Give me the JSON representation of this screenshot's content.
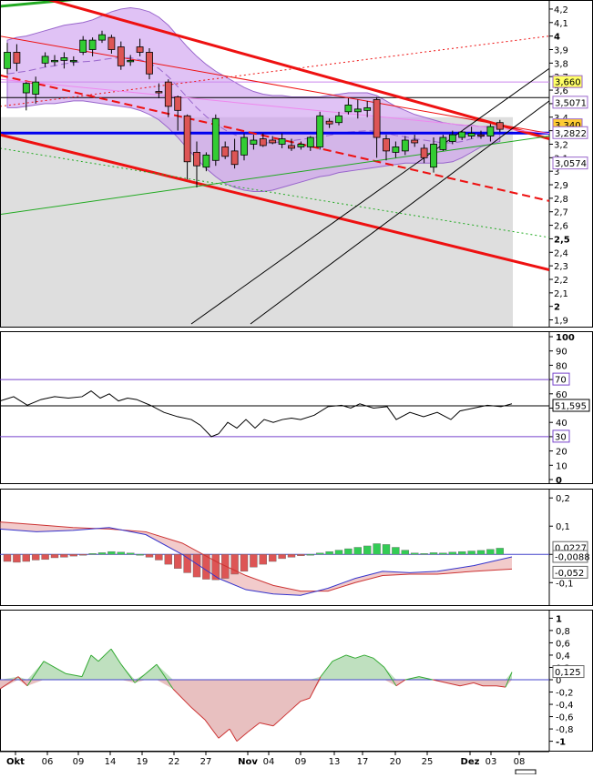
{
  "chart_data": [
    {
      "type": "candlestick",
      "title": "",
      "x_labels": [
        "Okt",
        "06",
        "09",
        "14",
        "19",
        "22",
        "27",
        "Nov",
        "04",
        "09",
        "13",
        "17",
        "20",
        "25",
        "Dez",
        "03",
        "08"
      ],
      "y_ticks": [
        "4,2",
        "4,1",
        "4",
        "3,9",
        "3,8",
        "3,7",
        "3,6",
        "3,5",
        "3,4",
        "3,3",
        "3,2",
        "3,1",
        "3",
        "2,9",
        "2,8",
        "2,7",
        "2,6",
        "2,5",
        "2,4",
        "2,3",
        "2,2",
        "2,1",
        "2",
        "1,9"
      ],
      "ylim": [
        1.87,
        4.24
      ],
      "badges": [
        {
          "label": "3,660",
          "value": 3.66,
          "color": "#ffff66"
        },
        {
          "label": "3,5071",
          "value": 3.5071,
          "color": "#ffffff"
        },
        {
          "label": "3,340",
          "value": 3.34,
          "color": "#ffcc33"
        },
        {
          "label": "3,2822",
          "value": 3.2822,
          "color": "#ffffff"
        },
        {
          "label": "3,0574",
          "value": 3.0574,
          "color": "#ffffff"
        }
      ],
      "candles": [
        {
          "o": 3.76,
          "h": 3.95,
          "l": 3.72,
          "c": 3.88
        },
        {
          "o": 3.88,
          "h": 3.94,
          "l": 3.74,
          "c": 3.8
        },
        {
          "o": 3.58,
          "h": 3.66,
          "l": 3.45,
          "c": 3.65
        },
        {
          "o": 3.57,
          "h": 3.7,
          "l": 3.5,
          "c": 3.66
        },
        {
          "o": 3.8,
          "h": 3.88,
          "l": 3.77,
          "c": 3.85
        },
        {
          "o": 3.82,
          "h": 3.86,
          "l": 3.78,
          "c": 3.82
        },
        {
          "o": 3.82,
          "h": 3.88,
          "l": 3.76,
          "c": 3.84
        },
        {
          "o": 3.82,
          "h": 3.85,
          "l": 3.78,
          "c": 3.82
        },
        {
          "o": 3.88,
          "h": 4.0,
          "l": 3.86,
          "c": 3.97
        },
        {
          "o": 3.9,
          "h": 3.99,
          "l": 3.85,
          "c": 3.97
        },
        {
          "o": 3.97,
          "h": 4.04,
          "l": 3.95,
          "c": 4.01
        },
        {
          "o": 3.99,
          "h": 4.01,
          "l": 3.87,
          "c": 3.9
        },
        {
          "o": 3.92,
          "h": 3.96,
          "l": 3.75,
          "c": 3.78
        },
        {
          "o": 3.82,
          "h": 3.86,
          "l": 3.78,
          "c": 3.82
        },
        {
          "o": 3.92,
          "h": 3.98,
          "l": 3.85,
          "c": 3.88
        },
        {
          "o": 3.88,
          "h": 3.91,
          "l": 3.68,
          "c": 3.72
        },
        {
          "o": 3.59,
          "h": 3.65,
          "l": 3.54,
          "c": 3.58
        },
        {
          "o": 3.66,
          "h": 3.68,
          "l": 3.4,
          "c": 3.48
        },
        {
          "o": 3.55,
          "h": 3.56,
          "l": 3.3,
          "c": 3.45
        },
        {
          "o": 3.41,
          "h": 3.42,
          "l": 2.94,
          "c": 3.07
        },
        {
          "o": 3.14,
          "h": 3.22,
          "l": 2.88,
          "c": 3.04
        },
        {
          "o": 3.03,
          "h": 3.14,
          "l": 3.0,
          "c": 3.12
        },
        {
          "o": 3.08,
          "h": 3.42,
          "l": 3.04,
          "c": 3.39
        },
        {
          "o": 3.18,
          "h": 3.22,
          "l": 3.09,
          "c": 3.11
        },
        {
          "o": 3.15,
          "h": 3.24,
          "l": 3.02,
          "c": 3.05
        },
        {
          "o": 3.12,
          "h": 3.28,
          "l": 3.08,
          "c": 3.25
        },
        {
          "o": 3.2,
          "h": 3.27,
          "l": 3.16,
          "c": 3.23
        },
        {
          "o": 3.24,
          "h": 3.28,
          "l": 3.18,
          "c": 3.19
        },
        {
          "o": 3.23,
          "h": 3.26,
          "l": 3.2,
          "c": 3.21
        },
        {
          "o": 3.2,
          "h": 3.28,
          "l": 3.17,
          "c": 3.24
        },
        {
          "o": 3.19,
          "h": 3.24,
          "l": 3.15,
          "c": 3.17
        },
        {
          "o": 3.18,
          "h": 3.22,
          "l": 3.16,
          "c": 3.2
        },
        {
          "o": 3.18,
          "h": 3.26,
          "l": 3.15,
          "c": 3.25
        },
        {
          "o": 3.18,
          "h": 3.44,
          "l": 3.16,
          "c": 3.41
        },
        {
          "o": 3.37,
          "h": 3.39,
          "l": 3.32,
          "c": 3.35
        },
        {
          "o": 3.36,
          "h": 3.44,
          "l": 3.34,
          "c": 3.41
        },
        {
          "o": 3.44,
          "h": 3.54,
          "l": 3.42,
          "c": 3.49
        },
        {
          "o": 3.44,
          "h": 3.53,
          "l": 3.39,
          "c": 3.46
        },
        {
          "o": 3.45,
          "h": 3.52,
          "l": 3.4,
          "c": 3.47
        },
        {
          "o": 3.53,
          "h": 3.55,
          "l": 3.1,
          "c": 3.25
        },
        {
          "o": 3.24,
          "h": 3.27,
          "l": 3.08,
          "c": 3.15
        },
        {
          "o": 3.14,
          "h": 3.22,
          "l": 3.1,
          "c": 3.18
        },
        {
          "o": 3.15,
          "h": 3.26,
          "l": 3.12,
          "c": 3.23
        },
        {
          "o": 3.23,
          "h": 3.27,
          "l": 3.18,
          "c": 3.21
        },
        {
          "o": 3.17,
          "h": 3.2,
          "l": 3.06,
          "c": 3.1
        },
        {
          "o": 3.03,
          "h": 3.25,
          "l": 2.99,
          "c": 3.2
        },
        {
          "o": 3.16,
          "h": 3.27,
          "l": 3.15,
          "c": 3.25
        },
        {
          "o": 3.22,
          "h": 3.3,
          "l": 3.2,
          "c": 3.27
        },
        {
          "o": 3.25,
          "h": 3.3,
          "l": 3.23,
          "c": 3.29
        },
        {
          "o": 3.26,
          "h": 3.33,
          "l": 3.24,
          "c": 3.28
        },
        {
          "o": 3.27,
          "h": 3.3,
          "l": 3.24,
          "c": 3.26
        },
        {
          "o": 3.26,
          "h": 3.35,
          "l": 3.22,
          "c": 3.33
        },
        {
          "o": 3.36,
          "h": 3.38,
          "l": 3.29,
          "c": 3.31
        }
      ],
      "bollinger": {
        "upper": [
          3.97,
          3.99,
          4.0,
          4.02,
          4.04,
          4.06,
          4.08,
          4.09,
          4.1,
          4.12,
          4.15,
          4.18,
          4.2,
          4.21,
          4.2,
          4.18,
          4.14,
          4.08,
          4.0,
          3.92,
          3.85,
          3.79,
          3.74,
          3.7,
          3.66,
          3.62,
          3.59,
          3.57,
          3.56,
          3.56,
          3.55,
          3.55,
          3.55,
          3.55,
          3.56,
          3.57,
          3.58,
          3.58,
          3.58,
          3.56,
          3.52,
          3.48,
          3.45,
          3.42,
          3.4,
          3.38,
          3.36,
          3.35,
          3.34,
          3.34,
          3.33,
          3.33,
          3.33
        ],
        "lower": [
          3.47,
          3.47,
          3.48,
          3.49,
          3.5,
          3.5,
          3.51,
          3.52,
          3.52,
          3.51,
          3.5,
          3.49,
          3.48,
          3.47,
          3.45,
          3.42,
          3.38,
          3.32,
          3.25,
          3.17,
          3.09,
          3.02,
          2.96,
          2.91,
          2.88,
          2.86,
          2.85,
          2.85,
          2.86,
          2.88,
          2.9,
          2.92,
          2.94,
          2.96,
          2.97,
          2.99,
          3.0,
          3.01,
          3.02,
          3.03,
          3.04,
          3.05,
          3.06,
          3.06,
          3.06,
          3.06,
          3.06,
          3.07,
          3.1,
          3.14,
          3.18,
          3.2,
          3.22
        ]
      },
      "overlays": {
        "gray_area_top": 3.4,
        "horizontal_levels": [
          {
            "value": 3.545,
            "color": "#000000",
            "width": 1
          },
          {
            "value": 3.66,
            "color": "#cc88ee",
            "width": 1
          },
          {
            "value": 3.282,
            "color": "#0000ee",
            "width": 3
          }
        ],
        "trendlines": [
          {
            "x1": 0,
            "y1": 4.22,
            "x2": 240,
            "y2": 4.37,
            "color": "#22aa22",
            "width": 3,
            "dash": ""
          },
          {
            "x1": 0,
            "y1": 4.37,
            "x2": 603,
            "y2": 3.24,
            "color": "#ee1111",
            "width": 3,
            "dash": ""
          },
          {
            "x1": 0,
            "y1": 3.27,
            "x2": 603,
            "y2": 2.27,
            "color": "#ee1111",
            "width": 3,
            "dash": ""
          },
          {
            "x1": 0,
            "y1": 3.71,
            "x2": 603,
            "y2": 2.78,
            "color": "#ee1111",
            "width": 2,
            "dash": "9,5"
          },
          {
            "x1": 0,
            "y1": 4.0,
            "x2": 603,
            "y2": 3.28,
            "color": "#ee1111",
            "width": 1,
            "dash": ""
          },
          {
            "x1": 0,
            "y1": 3.48,
            "x2": 603,
            "y2": 4.0,
            "color": "#ee1111",
            "width": 1,
            "dash": "2,3"
          },
          {
            "x1": 0,
            "y1": 3.68,
            "x2": 603,
            "y2": 3.28,
            "color": "#ee88ee",
            "width": 1,
            "dash": ""
          },
          {
            "x1": 0,
            "y1": 2.68,
            "x2": 603,
            "y2": 3.26,
            "color": "#22aa22",
            "width": 1,
            "dash": ""
          },
          {
            "x1": 0,
            "y1": 3.17,
            "x2": 603,
            "y2": 2.51,
            "color": "#22aa22",
            "width": 1,
            "dash": "2,3"
          },
          {
            "x1": 210,
            "y1": 1.87,
            "x2": 603,
            "y2": 3.76,
            "color": "#000000",
            "width": 1,
            "dash": ""
          },
          {
            "x1": 275,
            "y1": 1.87,
            "x2": 603,
            "y2": 3.52,
            "color": "#000000",
            "width": 1,
            "dash": ""
          }
        ]
      }
    },
    {
      "type": "line",
      "name": "RSI",
      "y_ticks": [
        "100",
        "90",
        "80",
        "70",
        "60",
        "50",
        "40",
        "30",
        "20",
        "10",
        "0"
      ],
      "ylim": [
        0,
        100
      ],
      "levels": [
        70,
        30
      ],
      "badges": [
        {
          "label": "51,595",
          "value": 51.6
        },
        {
          "label": "70",
          "value": 70
        },
        {
          "label": "30",
          "value": 30
        }
      ],
      "x": [
        0,
        15,
        30,
        45,
        60,
        75,
        90,
        100,
        110,
        120,
        130,
        140,
        150,
        165,
        180,
        195,
        210,
        220,
        232,
        240,
        250,
        260,
        270,
        280,
        290,
        300,
        310,
        320,
        330,
        345,
        360,
        375,
        385,
        395,
        410,
        425,
        435,
        450,
        465,
        480,
        495,
        505,
        520,
        535,
        550,
        562
      ],
      "values": [
        55,
        58,
        52,
        56,
        58,
        57,
        58,
        62,
        57,
        60,
        55,
        57,
        56,
        52,
        47,
        44,
        42,
        38,
        30,
        32,
        40,
        36,
        42,
        36,
        42,
        40,
        42,
        43,
        42,
        45,
        51,
        52,
        50,
        53,
        50,
        51,
        42,
        47,
        44,
        47,
        42,
        48,
        50,
        52,
        51,
        53
      ]
    },
    {
      "type": "bar+line",
      "name": "MACD",
      "y_ticks": [
        "0,2",
        "0,1",
        "0",
        "-0,1"
      ],
      "ylim": [
        -0.17,
        0.22
      ],
      "badges": [
        {
          "label": "0,0227",
          "value": 0.0227
        },
        {
          "label": "-0,0088",
          "value": -0.0088
        },
        {
          "label": "-0,052",
          "value": -0.052
        }
      ],
      "histogram": [
        -0.025,
        -0.028,
        -0.025,
        -0.02,
        -0.018,
        -0.012,
        -0.01,
        -0.006,
        -0.003,
        0.003,
        0.006,
        0.01,
        0.008,
        0.005,
        0.0,
        -0.01,
        -0.02,
        -0.035,
        -0.05,
        -0.065,
        -0.08,
        -0.088,
        -0.09,
        -0.085,
        -0.07,
        -0.06,
        -0.045,
        -0.035,
        -0.025,
        -0.015,
        -0.01,
        -0.005,
        0.0,
        0.005,
        0.01,
        0.015,
        0.02,
        0.025,
        0.03,
        0.038,
        0.035,
        0.025,
        0.015,
        0.005,
        0.003,
        0.006,
        0.005,
        0.008,
        0.01,
        0.012,
        0.014,
        0.018,
        0.022
      ],
      "macd_line": {
        "x": [
          0,
          40,
          80,
          120,
          160,
          200,
          240,
          270,
          300,
          330,
          360,
          390,
          420,
          450,
          480,
          520,
          562
        ],
        "values": [
          0.09,
          0.08,
          0.085,
          0.095,
          0.07,
          0.0,
          -0.085,
          -0.125,
          -0.14,
          -0.145,
          -0.12,
          -0.085,
          -0.06,
          -0.065,
          -0.06,
          -0.04,
          -0.009
        ]
      },
      "signal_line": {
        "x": [
          0,
          40,
          80,
          120,
          160,
          200,
          240,
          270,
          300,
          330,
          360,
          390,
          420,
          450,
          480,
          520,
          562
        ],
        "values": [
          0.115,
          0.105,
          0.095,
          0.09,
          0.08,
          0.04,
          -0.03,
          -0.075,
          -0.11,
          -0.13,
          -0.13,
          -0.1,
          -0.075,
          -0.07,
          -0.07,
          -0.06,
          -0.052
        ]
      }
    },
    {
      "type": "area",
      "name": "Momentum",
      "y_ticks": [
        "1",
        "0,8",
        "0,6",
        "0,4",
        "0,2",
        "0",
        "-0,2",
        "-0,4",
        "-0,6",
        "-0,8",
        "-1"
      ],
      "ylim": [
        -1.05,
        1.05
      ],
      "badges": [
        {
          "label": "0,125",
          "value": 0.125
        }
      ],
      "x": [
        0,
        20,
        30,
        48,
        72,
        90,
        100,
        108,
        122,
        133,
        148,
        160,
        172,
        190,
        210,
        225,
        240,
        252,
        260,
        272,
        285,
        300,
        315,
        330,
        340,
        352,
        365,
        380,
        390,
        400,
        410,
        422,
        435,
        445,
        460,
        475,
        490,
        505,
        520,
        530,
        545,
        555,
        562
      ],
      "values": [
        -0.15,
        0.05,
        -0.1,
        0.3,
        0.1,
        0.05,
        0.4,
        0.3,
        0.5,
        0.25,
        -0.05,
        0.1,
        0.25,
        -0.15,
        -0.45,
        -0.65,
        -0.95,
        -0.8,
        -1.0,
        -0.85,
        -0.7,
        -0.75,
        -0.55,
        -0.35,
        -0.3,
        0.05,
        0.3,
        0.4,
        0.35,
        0.4,
        0.35,
        0.2,
        -0.1,
        0.0,
        0.05,
        0.0,
        -0.05,
        -0.1,
        -0.05,
        -0.1,
        -0.1,
        -0.12,
        0.125
      ]
    }
  ]
}
